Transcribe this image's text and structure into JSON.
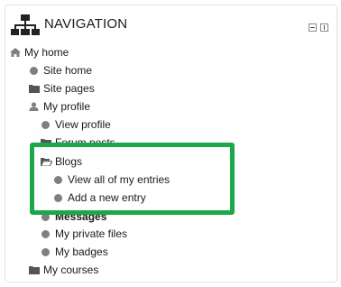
{
  "block": {
    "title": "NAVIGATION"
  },
  "tree": {
    "my_home": "My home",
    "site_home": "Site home",
    "site_pages": "Site pages",
    "my_profile": "My profile",
    "view_profile": "View profile",
    "forum_posts": "Forum posts",
    "blogs": "Blogs",
    "view_all_entries": "View all of my entries",
    "add_new_entry": "Add a new entry",
    "messages": "Messages",
    "my_private_files": "My private files",
    "my_badges": "My badges",
    "my_courses": "My courses"
  },
  "colors": {
    "highlight_border": "#1aa84a",
    "icon_gray": "#7f7f7f"
  },
  "icons": {
    "header": "sitemap-icon",
    "home": "home-icon",
    "profile": "user-icon",
    "folder": "folder-icon",
    "folder_open": "folder-open-icon",
    "bullet": "circle-icon"
  }
}
